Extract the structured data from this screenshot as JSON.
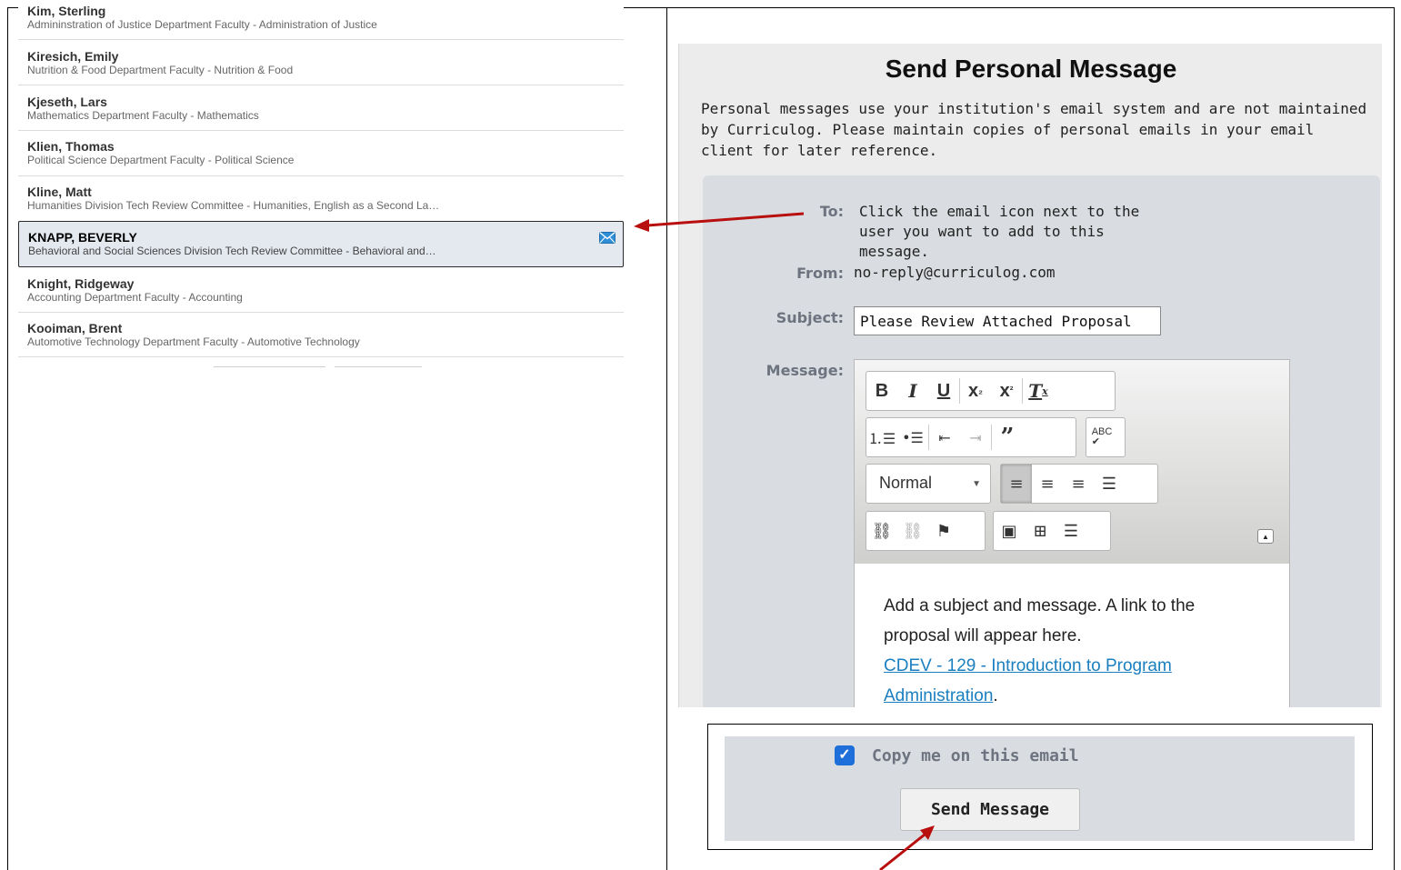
{
  "user_list": {
    "users": [
      {
        "name": "Kim, Sterling",
        "subtitle": "Admininstration of Justice Department Faculty - Administration of Justice"
      },
      {
        "name": "Kiresich, Emily",
        "subtitle": "Nutrition & Food Department Faculty - Nutrition & Food"
      },
      {
        "name": "Kjeseth, Lars",
        "subtitle": "Mathematics Department Faculty - Mathematics"
      },
      {
        "name": "Klien, Thomas",
        "subtitle": "Political Science Department Faculty - Political Science"
      },
      {
        "name": "Kline, Matt",
        "subtitle": "Humanities Division Tech Review Committee - Humanities, English as a Second La…"
      },
      {
        "name": "KNAPP, BEVERLY",
        "subtitle": "Behavioral and Social Sciences Division Tech Review Committee - Behavioral and…",
        "selected": true
      },
      {
        "name": "Knight, Ridgeway",
        "subtitle": "Accounting Department Faculty - Accounting"
      },
      {
        "name": "Kooiman, Brent",
        "subtitle": "Automotive Technology Department Faculty - Automotive Technology"
      }
    ],
    "selected_icon": "envelope-icon"
  },
  "message_panel": {
    "title": "Send Personal Message",
    "intro": "Personal messages use your institution's email system and are not maintained by Curriculog. Please maintain copies of personal emails in your email client for later reference.",
    "to_label": "To:",
    "to_value": "Click the email icon next to the user you want to add to this message.",
    "from_label": "From:",
    "from_value": "no-reply@curriculog.com",
    "subject_label": "Subject:",
    "subject_value": "Please Review Attached Proposal",
    "message_label": "Message:",
    "format_select": "Normal",
    "editor_text_1": "Add a subject and message.  A link to the  proposal will appear here.",
    "editor_link_text": "CDEV - 129 - Introduction to Program Administration"
  },
  "bottom": {
    "copy_checkbox_label": "Copy me on this email",
    "copy_checked": true,
    "send_button": "Send Message"
  },
  "colors": {
    "arrow": "#b80f0f",
    "checkbox": "#1e6fd9",
    "link": "#1a7fc0"
  }
}
